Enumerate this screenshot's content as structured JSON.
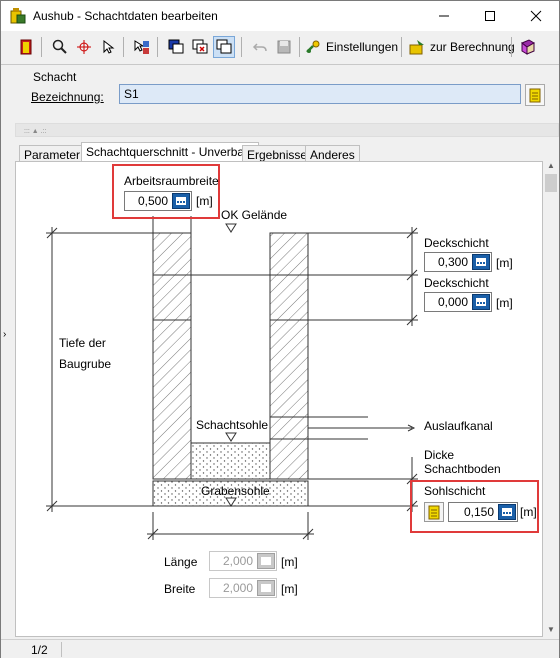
{
  "window": {
    "title": "Aushub - Schachtdaten bearbeiten"
  },
  "toolbar": {
    "settings_label": "Einstellungen",
    "calculation_label": "zur Berechnung"
  },
  "shaft": {
    "group_label": "Schacht",
    "designation_label": "Bezeichnung:",
    "designation_value": "S1"
  },
  "tabs": [
    "Parameter",
    "Schachtquerschnitt - Unverbaut",
    "Ergebnisse",
    "Anderes"
  ],
  "drawing": {
    "working_space": {
      "label": "Arbeitsraumbreite",
      "value": "0,500",
      "unit": "[m]"
    },
    "ground_label": "OK Gelände",
    "cover_layer_1": {
      "label": "Deckschicht",
      "value": "0,300",
      "unit": "[m]"
    },
    "cover_layer_2": {
      "label": "Deckschicht",
      "value": "0,000",
      "unit": "[m]"
    },
    "pit_depth_line1": "Tiefe der",
    "pit_depth_line2": "Baugrube",
    "shaft_bottom_label": "Schachtsohle",
    "outlet_label": "Auslaufkanal",
    "bottom_thickness_line1": "Dicke",
    "bottom_thickness_line2": "Schachtboden",
    "base_layer": {
      "label": "Sohlschicht",
      "value": "0,150",
      "unit": "[m]"
    },
    "trench_bottom_label": "Grabensohle",
    "length": {
      "label": "Länge",
      "value": "2,000",
      "unit": "[m]"
    },
    "width": {
      "label": "Breite",
      "value": "2,000",
      "unit": "[m]"
    }
  },
  "status": {
    "page": "1/2"
  },
  "colors": {
    "highlight": "#e03a3a",
    "field_button": "#1a5fa8",
    "input_bg": "#dde9f7"
  }
}
